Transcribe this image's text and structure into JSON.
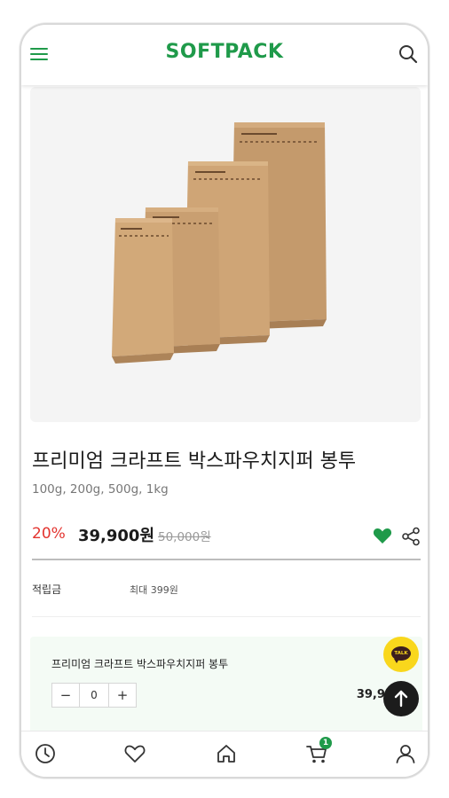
{
  "header": {
    "logo": "SOFTPACK",
    "brand_color": "#1f9a4a"
  },
  "product": {
    "title": "프리미엄 크라프트 박스파우치지퍼 봉투",
    "options": "100g, 200g, 500g, 1kg",
    "discount": "20%",
    "price": "39,900원",
    "original_price": "50,000원",
    "points_label": "적립금",
    "points_value": "최대 399원"
  },
  "order": {
    "product_name": "프리미엄 크라프트 박스파우치지퍼 봉투",
    "quantity": "0",
    "minus": "−",
    "plus": "+",
    "price": "39,900"
  },
  "floating": {
    "talk_label": "TALK"
  },
  "bottom_nav": {
    "cart_count": "1"
  },
  "icons": [
    "menu-icon",
    "search-icon",
    "heart-icon",
    "share-icon",
    "kakao-talk-icon",
    "arrow-up-icon",
    "clock-icon",
    "heart-outline-icon",
    "home-icon",
    "cart-icon",
    "user-icon"
  ]
}
